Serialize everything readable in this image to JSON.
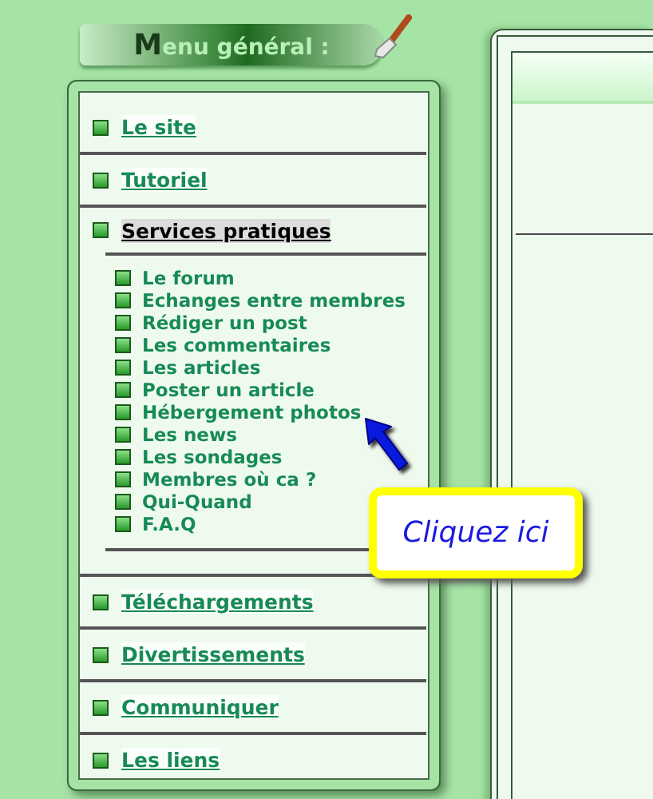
{
  "menu_banner": {
    "title": "Menu général :"
  },
  "menu": [
    {
      "label": "Le site",
      "selected": false
    },
    {
      "label": "Tutoriel",
      "selected": false
    },
    {
      "label": "Services pratiques",
      "selected": true,
      "children": [
        {
          "label": "Le forum"
        },
        {
          "label": "Echanges entre membres"
        },
        {
          "label": "Rédiger un post"
        },
        {
          "label": "Les commentaires"
        },
        {
          "label": "Les articles"
        },
        {
          "label": "Poster un article"
        },
        {
          "label": "Hébergement photos"
        },
        {
          "label": "Les news"
        },
        {
          "label": "Les sondages"
        },
        {
          "label": "Membres où ca ?"
        },
        {
          "label": "Qui-Quand"
        },
        {
          "label": "F.A.Q"
        }
      ]
    },
    {
      "label": "Téléchargements",
      "selected": false
    },
    {
      "label": "Divertissements",
      "selected": false
    },
    {
      "label": "Communiquer",
      "selected": false
    },
    {
      "label": "Les liens",
      "selected": false
    }
  ],
  "callout": {
    "text": "Cliquez ici"
  }
}
